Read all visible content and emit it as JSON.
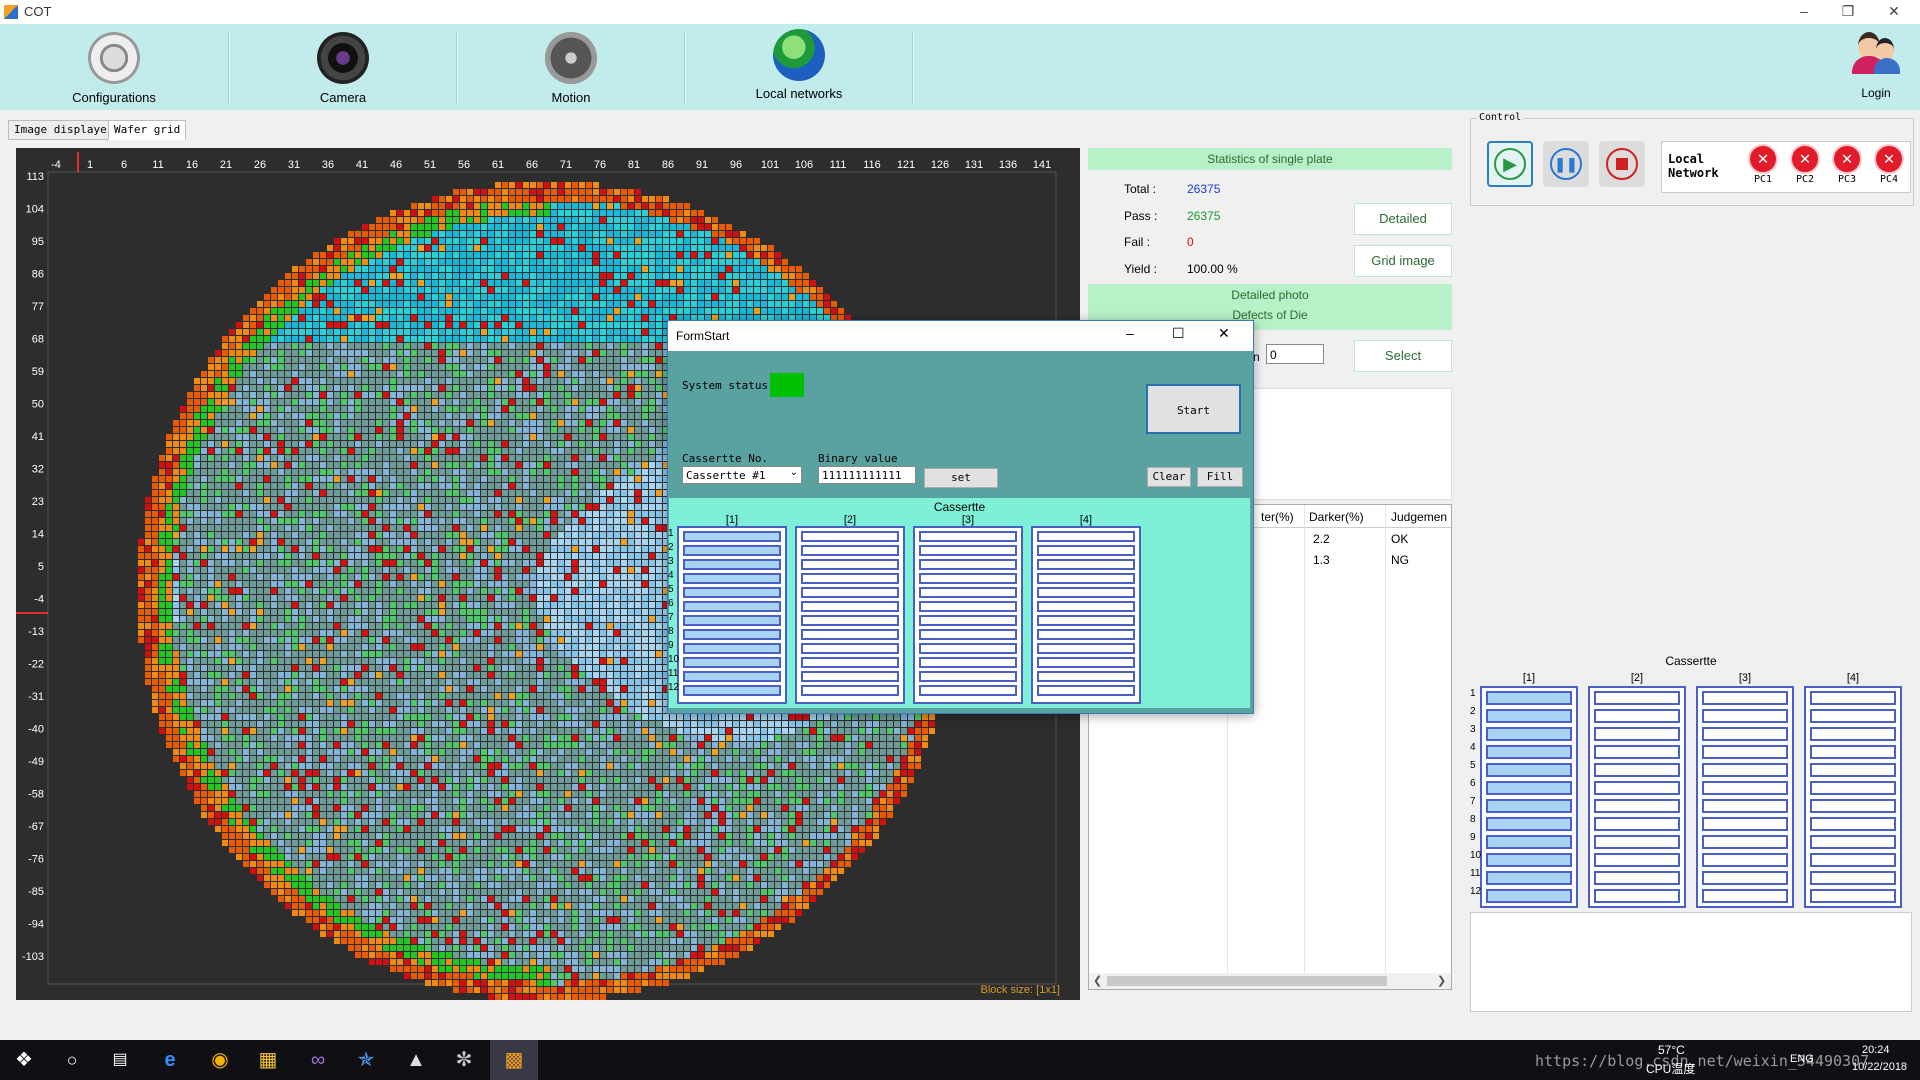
{
  "window": {
    "title": "COT"
  },
  "toolbar": {
    "items": [
      {
        "label": "Configurations"
      },
      {
        "label": "Camera"
      },
      {
        "label": "Motion"
      },
      {
        "label": "Local networks"
      }
    ],
    "login": "Login"
  },
  "tabs": [
    {
      "label": "Image displayer"
    },
    {
      "label": "Wafer grid"
    }
  ],
  "wafer": {
    "x_ticks": [
      "-4",
      "1",
      "6",
      "11",
      "16",
      "21",
      "26",
      "31",
      "36",
      "41",
      "46",
      "51",
      "56",
      "61",
      "66",
      "71",
      "76",
      "81",
      "86",
      "91",
      "96",
      "101",
      "106",
      "111",
      "116",
      "121",
      "126",
      "131",
      "136",
      "141"
    ],
    "y_ticks": [
      "113",
      "104",
      "95",
      "86",
      "77",
      "68",
      "59",
      "50",
      "41",
      "32",
      "23",
      "14",
      "5",
      "-4",
      "-13",
      "-22",
      "-31",
      "-40",
      "-49",
      "-58",
      "-67",
      "-76",
      "-85",
      "-94",
      "-103"
    ],
    "block_size": "Block size: [1x1]"
  },
  "stats": {
    "header": "Statistics of single plate",
    "total_label": "Total :",
    "total": "26375",
    "pass_label": "Pass :",
    "pass": "26375",
    "fail_label": "Fail :",
    "fail": "0",
    "yield_label": "Yield :",
    "yield": "100.00 %",
    "detailed_btn": "Detailed",
    "grid_image_btn": "Grid image",
    "detailed_photo": "Detailed photo",
    "defects_of_die": "Defects of Die",
    "n_label": "n",
    "n_value": "0",
    "select_btn": "Select",
    "table": {
      "headers": [
        "ter(%)",
        "Darker(%)",
        "Judgemen"
      ],
      "rows": [
        [
          "",
          "2.2",
          "OK"
        ],
        [
          "",
          "1.3",
          "NG"
        ]
      ]
    }
  },
  "control": {
    "legend": "Control",
    "network_label_1": "Local",
    "network_label_2": "Network",
    "pcs": [
      "PC1",
      "PC2",
      "PC3",
      "PC4"
    ]
  },
  "cassette_panel": {
    "title": "Cassertte",
    "columns": [
      "[1]",
      "[2]",
      "[3]",
      "[4]"
    ],
    "rows": [
      "1",
      "2",
      "3",
      "4",
      "5",
      "6",
      "7",
      "8",
      "9",
      "10",
      "11",
      "12"
    ]
  },
  "modal": {
    "title": "FormStart",
    "system_status": "System status",
    "status_color": "#00c000",
    "start_btn": "Start",
    "cassette_no_label": "Cassertte No.",
    "cassette_select": "Cassertte #1",
    "binary_label": "Binary value",
    "binary_value": "111111111111",
    "set_btn": "set",
    "clear_btn": "Clear",
    "fill_btn": "Fill",
    "cassette_title": "Cassertte",
    "columns": [
      "[1]",
      "[2]",
      "[3]",
      "[4]"
    ],
    "rows": [
      "1",
      "2",
      "3",
      "4",
      "5",
      "6",
      "7",
      "8",
      "9",
      "10",
      "11",
      "12"
    ]
  },
  "taskbar": {
    "watermark": "https://blog.csdn.net/weixin_34490307",
    "temp": "57°C",
    "cpu_label": "CPU温度",
    "lang": "ENG",
    "time": "20:24",
    "date": "10/22/2018"
  }
}
